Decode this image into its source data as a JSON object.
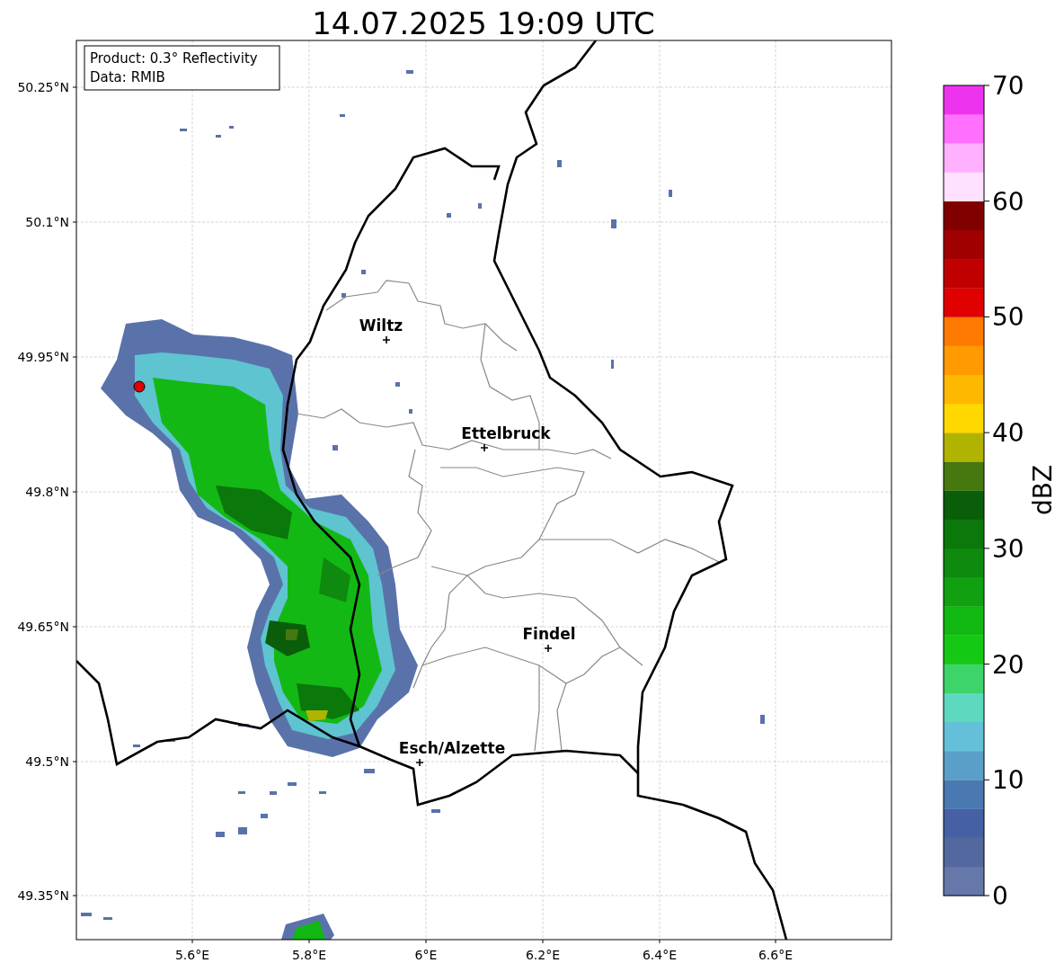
{
  "title": "14.07.2025 19:09 UTC",
  "legend": [
    "Product: 0.3° Reflectivity",
    "Data: RMIB"
  ],
  "x_ticks": [
    "5.6°E",
    "5.8°E",
    "6°E",
    "6.2°E",
    "6.4°E",
    "6.6°E"
  ],
  "y_ticks": [
    "50.25°N",
    "50.1°N",
    "49.95°N",
    "49.8°N",
    "49.65°N",
    "49.5°N",
    "49.35°N"
  ],
  "cities": [
    {
      "name": "Wiltz"
    },
    {
      "name": "Ettelbruck"
    },
    {
      "name": "Findel"
    },
    {
      "name": "Esch/Alzette"
    }
  ],
  "colorbar": {
    "label": "dBZ",
    "ticks": [
      "70",
      "60",
      "50",
      "40",
      "30",
      "20",
      "10",
      "0"
    ],
    "segments": [
      {
        "color": "#6677aa"
      },
      {
        "color": "#53689e"
      },
      {
        "color": "#4660a4"
      },
      {
        "color": "#4a78b0"
      },
      {
        "color": "#5a9fc8"
      },
      {
        "color": "#63c0d8"
      },
      {
        "color": "#5fd8c0"
      },
      {
        "color": "#3dd46a"
      },
      {
        "color": "#14c814"
      },
      {
        "color": "#12b812"
      },
      {
        "color": "#10a010"
      },
      {
        "color": "#0e8a0e"
      },
      {
        "color": "#0b780b"
      },
      {
        "color": "#0a5e0a"
      },
      {
        "color": "#467810"
      },
      {
        "color": "#b0b400"
      },
      {
        "color": "#ffd800"
      },
      {
        "color": "#ffb800"
      },
      {
        "color": "#ff9a00"
      },
      {
        "color": "#ff7a00"
      },
      {
        "color": "#e00000"
      },
      {
        "color": "#c00000"
      },
      {
        "color": "#a00000"
      },
      {
        "color": "#800000"
      },
      {
        "color": "#ffe0ff"
      },
      {
        "color": "#ffb0ff"
      },
      {
        "color": "#ff70ff"
      },
      {
        "color": "#ee33ee"
      }
    ]
  }
}
